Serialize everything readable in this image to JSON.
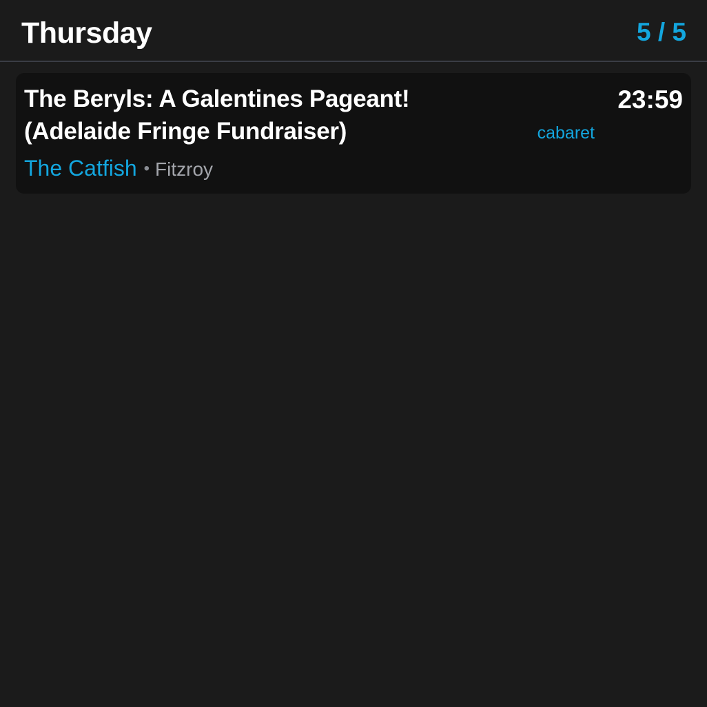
{
  "header": {
    "day": "Thursday",
    "counter": "5 / 5"
  },
  "events": [
    {
      "title": "The Beryls: A Galentines Pageant! (Adelaide Fringe Fundraiser)",
      "time": "23:59",
      "genre": "cabaret",
      "venue": "The Catfish",
      "separator": "•",
      "suburb": "Fitzroy"
    }
  ],
  "colors": {
    "background": "#1b1b1b",
    "card": "#111111",
    "accent": "#13a6de",
    "divider": "#3a3d45",
    "secondary_text": "#a3a5ab"
  }
}
